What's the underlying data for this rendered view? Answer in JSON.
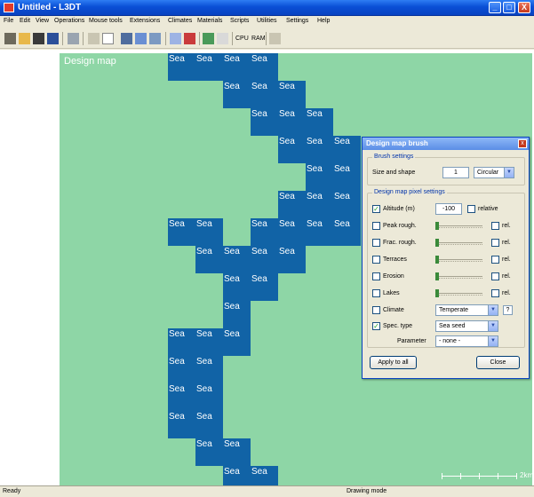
{
  "window": {
    "title": "Untitled - L3DT",
    "minimize": "_",
    "maximize": "□",
    "close": "X"
  },
  "menu": [
    "File",
    "Edit",
    "View",
    "Operations",
    "Mouse tools",
    "Extensions",
    "Climates",
    "Materials",
    "Scripts",
    "Utilities",
    "Settings",
    "Help"
  ],
  "toolbar": {
    "cpu_label": "CPU",
    "ram_label": "RAM"
  },
  "map": {
    "label": "Design map",
    "sea_text": "Sea",
    "scale_label": "2km",
    "colors": {
      "land": "#8ed6a6",
      "sea": "#1163a6"
    }
  },
  "dialog": {
    "title": "Design map brush",
    "close": "x",
    "brush_group": "Brush settings",
    "size_label": "Size and shape",
    "size_value": "1",
    "shape_value": "Circular",
    "pixel_group": "Design map pixel settings",
    "rows": [
      {
        "label": "Altitude (m)",
        "checked": true,
        "value": "-100",
        "rel_label": "relative",
        "rel_checked": false
      },
      {
        "label": "Peak rough.",
        "checked": false,
        "rel_label": "rel.",
        "rel_checked": false
      },
      {
        "label": "Frac. rough.",
        "checked": false,
        "rel_label": "rel.",
        "rel_checked": false
      },
      {
        "label": "Terraces",
        "checked": false,
        "rel_label": "rel.",
        "rel_checked": false
      },
      {
        "label": "Erosion",
        "checked": false,
        "rel_label": "rel.",
        "rel_checked": false
      },
      {
        "label": "Lakes",
        "checked": false,
        "rel_label": "rel.",
        "rel_checked": false
      }
    ],
    "climate_label": "Climate",
    "climate_checked": false,
    "climate_value": "Temperate",
    "climate_help": "?",
    "spec_label": "Spec. type",
    "spec_checked": true,
    "spec_value": "Sea seed",
    "param_label": "Parameter",
    "param_value": "- none -",
    "apply_label": "Apply to all",
    "close_label": "Close"
  },
  "status": {
    "left": "Ready",
    "mode": "Drawing mode"
  }
}
